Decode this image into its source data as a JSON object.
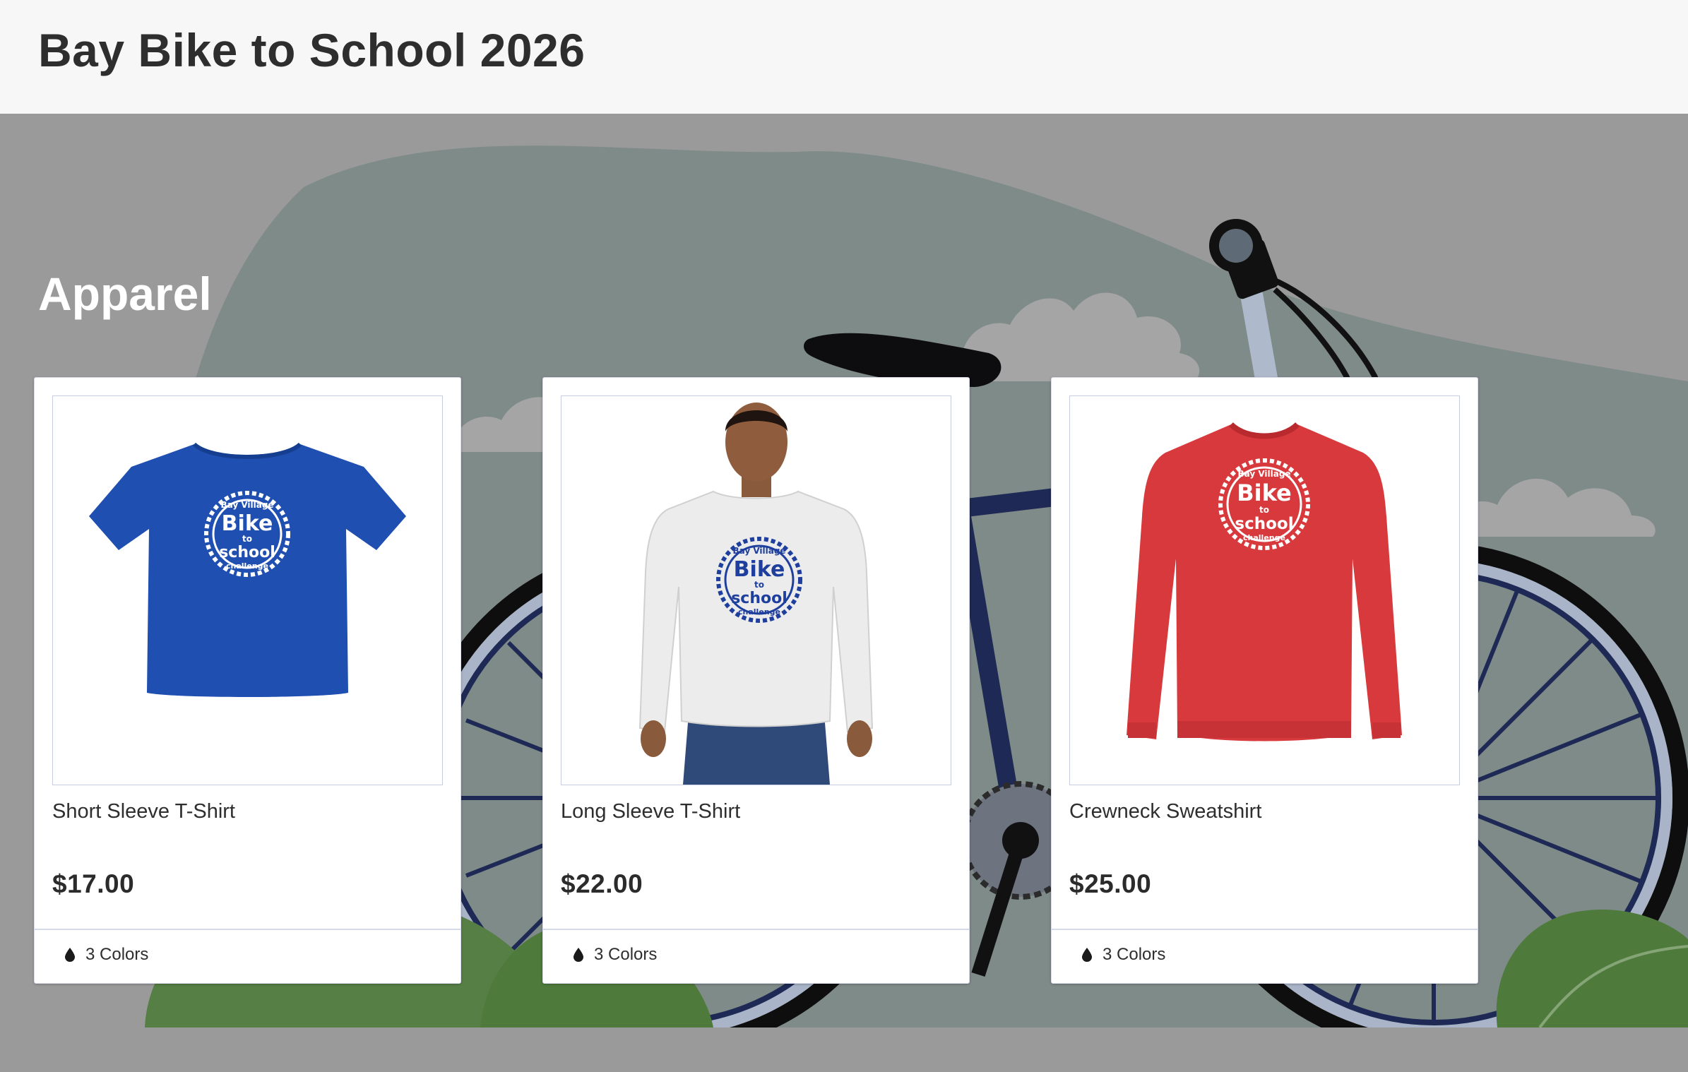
{
  "header": {
    "store_title": "Bay Bike to School 2026"
  },
  "section": {
    "title": "Apparel"
  },
  "products": [
    {
      "name": "Short Sleeve T-Shirt",
      "price": "$17.00",
      "colors_label": "3 Colors",
      "garment_color": "#1f4fb0",
      "print_color": "#ffffff"
    },
    {
      "name": "Long Sleeve T-Shirt",
      "price": "$22.00",
      "colors_label": "3 Colors",
      "garment_color": "#f2f2f2",
      "print_color": "#1f3f9e"
    },
    {
      "name": "Crewneck Sweatshirt",
      "price": "$25.00",
      "colors_label": "3 Colors",
      "garment_color": "#d7393c",
      "print_color": "#ffffff"
    }
  ],
  "logo_text": {
    "arc_top": "Bay Village",
    "line1": "Bike",
    "line2": "to",
    "line3": "school",
    "arc_bottom": "challenge"
  },
  "theme": {
    "header_bg": "#f7f7f7",
    "hero_bg": "#9a9a9a",
    "hill": "#7f8b88",
    "bike_frame": "#1e2a55",
    "wheel_rim": "#a9b4c8",
    "leaf": "#4e7a3c"
  }
}
